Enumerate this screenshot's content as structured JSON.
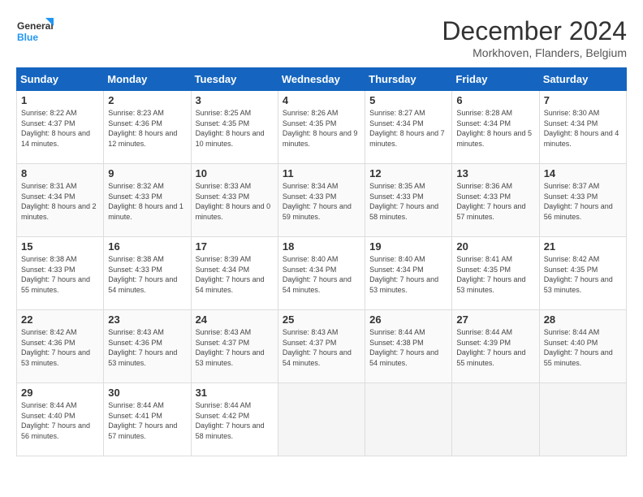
{
  "header": {
    "logo_line1": "General",
    "logo_line2": "Blue",
    "month_title": "December 2024",
    "location": "Morkhoven, Flanders, Belgium"
  },
  "weekdays": [
    "Sunday",
    "Monday",
    "Tuesday",
    "Wednesday",
    "Thursday",
    "Friday",
    "Saturday"
  ],
  "weeks": [
    [
      {
        "day": "1",
        "sunrise": "8:22 AM",
        "sunset": "4:37 PM",
        "daylight": "8 hours and 14 minutes"
      },
      {
        "day": "2",
        "sunrise": "8:23 AM",
        "sunset": "4:36 PM",
        "daylight": "8 hours and 12 minutes"
      },
      {
        "day": "3",
        "sunrise": "8:25 AM",
        "sunset": "4:35 PM",
        "daylight": "8 hours and 10 minutes"
      },
      {
        "day": "4",
        "sunrise": "8:26 AM",
        "sunset": "4:35 PM",
        "daylight": "8 hours and 9 minutes"
      },
      {
        "day": "5",
        "sunrise": "8:27 AM",
        "sunset": "4:34 PM",
        "daylight": "8 hours and 7 minutes"
      },
      {
        "day": "6",
        "sunrise": "8:28 AM",
        "sunset": "4:34 PM",
        "daylight": "8 hours and 5 minutes"
      },
      {
        "day": "7",
        "sunrise": "8:30 AM",
        "sunset": "4:34 PM",
        "daylight": "8 hours and 4 minutes"
      }
    ],
    [
      {
        "day": "8",
        "sunrise": "8:31 AM",
        "sunset": "4:34 PM",
        "daylight": "8 hours and 2 minutes"
      },
      {
        "day": "9",
        "sunrise": "8:32 AM",
        "sunset": "4:33 PM",
        "daylight": "8 hours and 1 minute"
      },
      {
        "day": "10",
        "sunrise": "8:33 AM",
        "sunset": "4:33 PM",
        "daylight": "8 hours and 0 minutes"
      },
      {
        "day": "11",
        "sunrise": "8:34 AM",
        "sunset": "4:33 PM",
        "daylight": "7 hours and 59 minutes"
      },
      {
        "day": "12",
        "sunrise": "8:35 AM",
        "sunset": "4:33 PM",
        "daylight": "7 hours and 58 minutes"
      },
      {
        "day": "13",
        "sunrise": "8:36 AM",
        "sunset": "4:33 PM",
        "daylight": "7 hours and 57 minutes"
      },
      {
        "day": "14",
        "sunrise": "8:37 AM",
        "sunset": "4:33 PM",
        "daylight": "7 hours and 56 minutes"
      }
    ],
    [
      {
        "day": "15",
        "sunrise": "8:38 AM",
        "sunset": "4:33 PM",
        "daylight": "7 hours and 55 minutes"
      },
      {
        "day": "16",
        "sunrise": "8:38 AM",
        "sunset": "4:33 PM",
        "daylight": "7 hours and 54 minutes"
      },
      {
        "day": "17",
        "sunrise": "8:39 AM",
        "sunset": "4:34 PM",
        "daylight": "7 hours and 54 minutes"
      },
      {
        "day": "18",
        "sunrise": "8:40 AM",
        "sunset": "4:34 PM",
        "daylight": "7 hours and 54 minutes"
      },
      {
        "day": "19",
        "sunrise": "8:40 AM",
        "sunset": "4:34 PM",
        "daylight": "7 hours and 53 minutes"
      },
      {
        "day": "20",
        "sunrise": "8:41 AM",
        "sunset": "4:35 PM",
        "daylight": "7 hours and 53 minutes"
      },
      {
        "day": "21",
        "sunrise": "8:42 AM",
        "sunset": "4:35 PM",
        "daylight": "7 hours and 53 minutes"
      }
    ],
    [
      {
        "day": "22",
        "sunrise": "8:42 AM",
        "sunset": "4:36 PM",
        "daylight": "7 hours and 53 minutes"
      },
      {
        "day": "23",
        "sunrise": "8:43 AM",
        "sunset": "4:36 PM",
        "daylight": "7 hours and 53 minutes"
      },
      {
        "day": "24",
        "sunrise": "8:43 AM",
        "sunset": "4:37 PM",
        "daylight": "7 hours and 53 minutes"
      },
      {
        "day": "25",
        "sunrise": "8:43 AM",
        "sunset": "4:37 PM",
        "daylight": "7 hours and 54 minutes"
      },
      {
        "day": "26",
        "sunrise": "8:44 AM",
        "sunset": "4:38 PM",
        "daylight": "7 hours and 54 minutes"
      },
      {
        "day": "27",
        "sunrise": "8:44 AM",
        "sunset": "4:39 PM",
        "daylight": "7 hours and 55 minutes"
      },
      {
        "day": "28",
        "sunrise": "8:44 AM",
        "sunset": "4:40 PM",
        "daylight": "7 hours and 55 minutes"
      }
    ],
    [
      {
        "day": "29",
        "sunrise": "8:44 AM",
        "sunset": "4:40 PM",
        "daylight": "7 hours and 56 minutes"
      },
      {
        "day": "30",
        "sunrise": "8:44 AM",
        "sunset": "4:41 PM",
        "daylight": "7 hours and 57 minutes"
      },
      {
        "day": "31",
        "sunrise": "8:44 AM",
        "sunset": "4:42 PM",
        "daylight": "7 hours and 58 minutes"
      },
      null,
      null,
      null,
      null
    ]
  ]
}
